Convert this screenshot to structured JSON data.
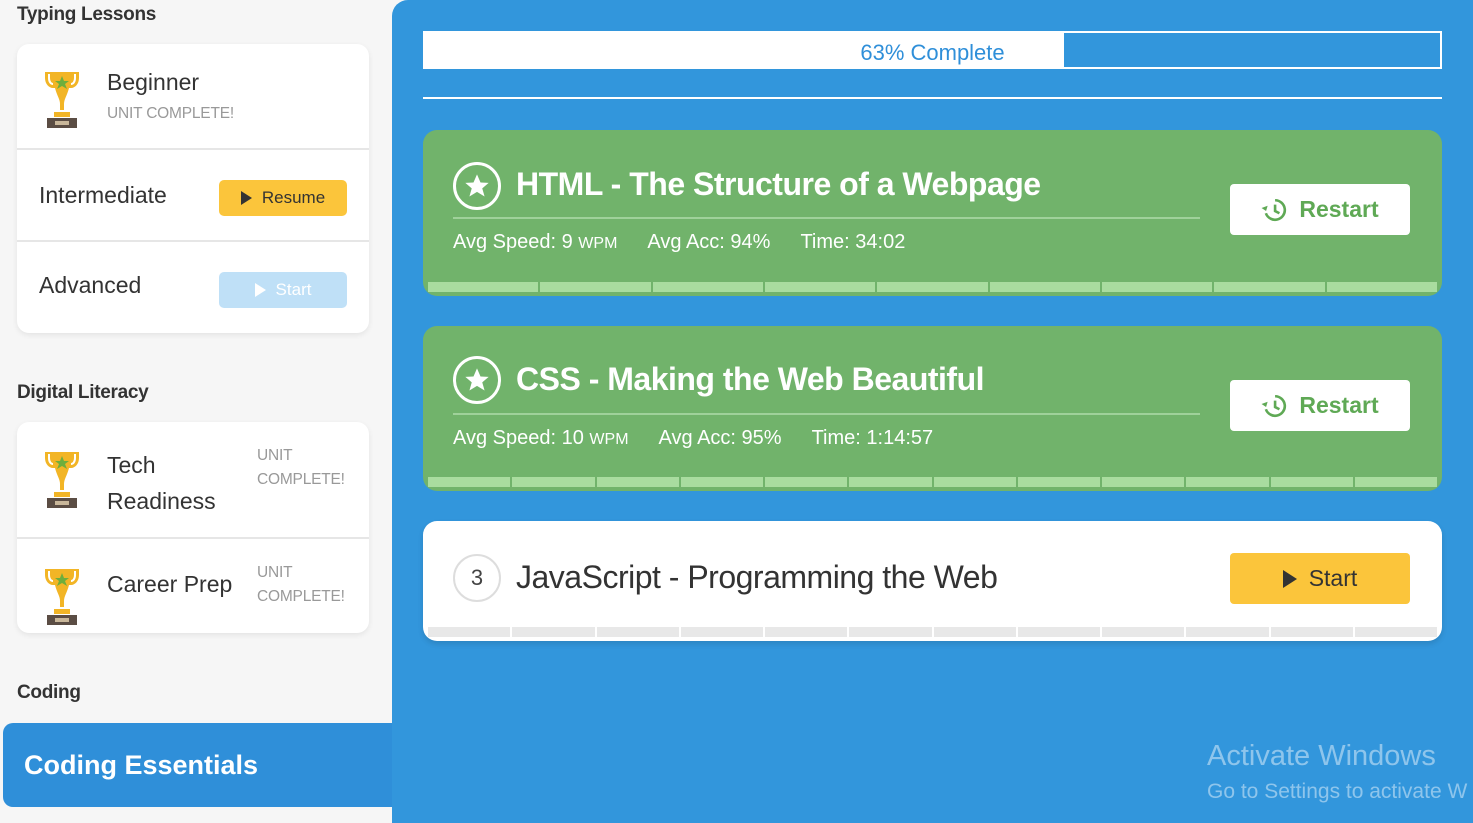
{
  "sidebar": {
    "sections": [
      {
        "title": "Typing Lessons",
        "items": [
          {
            "label": "Beginner",
            "status": "UNIT COMPLETE!"
          },
          {
            "label": "Intermediate",
            "button": "Resume"
          },
          {
            "label": "Advanced",
            "button": "Start"
          }
        ]
      },
      {
        "title": "Digital Literacy",
        "items": [
          {
            "label": "Tech Readiness",
            "status": "UNIT COMPLETE!"
          },
          {
            "label": "Career Prep",
            "status": "UNIT COMPLETE!"
          }
        ]
      },
      {
        "title": "Coding",
        "items": [
          {
            "label": "Coding Essentials",
            "active": true
          }
        ]
      }
    ]
  },
  "progress": {
    "label": "63% Complete",
    "fraction": 0.63
  },
  "lessons": [
    {
      "title": "HTML - The Structure of a Webpage",
      "completed": true,
      "speed_label": "Avg Speed: 9",
      "speed_unit": "WPM",
      "accuracy": "Avg Acc: 94%",
      "time": "Time: 34:02",
      "button": "Restart",
      "segments": 9
    },
    {
      "title": "CSS - Making the Web Beautiful",
      "completed": true,
      "speed_label": "Avg Speed: 10",
      "speed_unit": "WPM",
      "accuracy": "Avg Acc: 95%",
      "time": "Time: 1:14:57",
      "button": "Restart",
      "segments": 12
    },
    {
      "title": "JavaScript - Programming the Web",
      "completed": false,
      "number": "3",
      "button": "Start",
      "segments": 12
    }
  ],
  "watermark": {
    "title": "Activate Windows",
    "subtitle": "Go to Settings to activate W"
  },
  "colors": {
    "main_blue": "#3296dc",
    "complete_green": "#71b36b",
    "resume_yellow": "#fbc53b"
  }
}
